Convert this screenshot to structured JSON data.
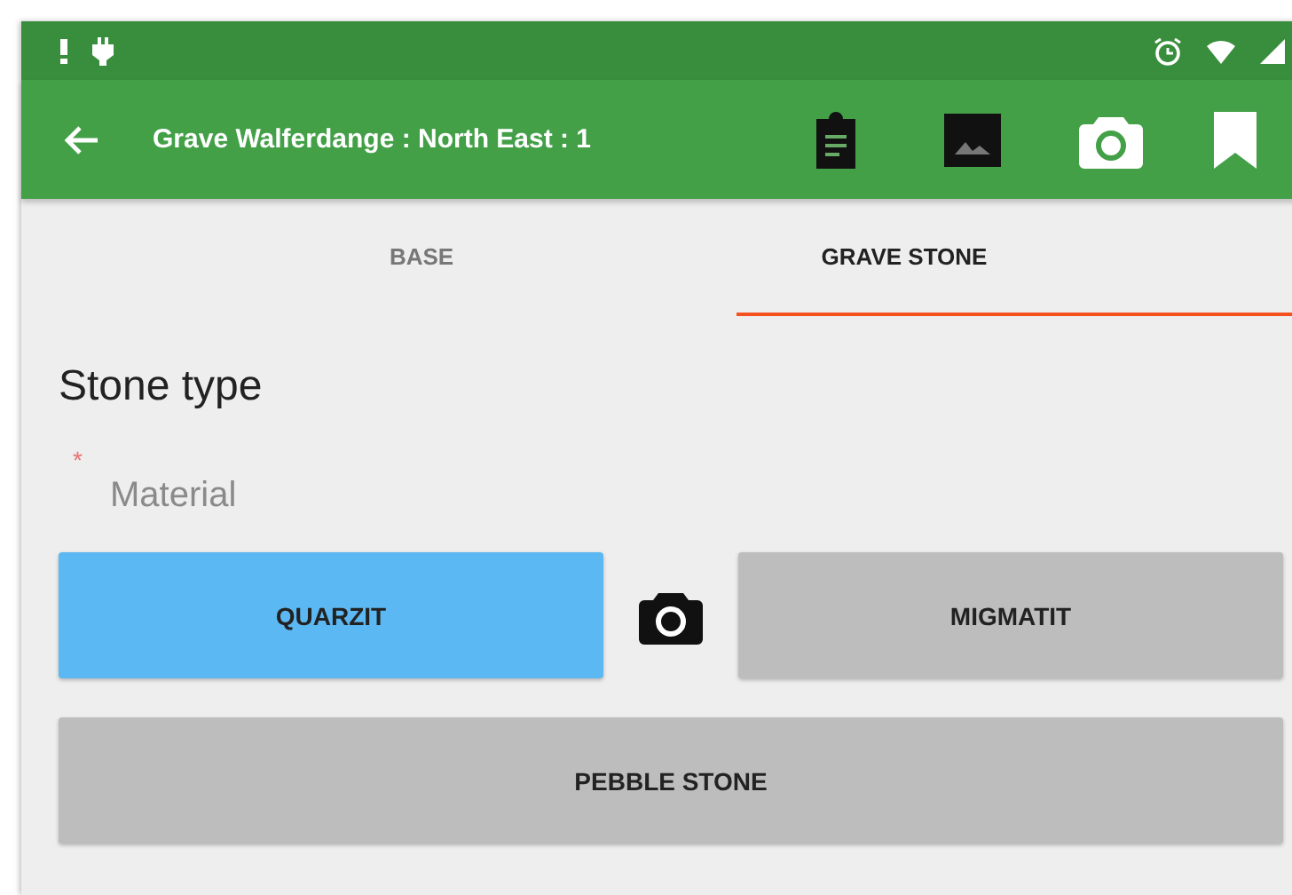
{
  "toolbar": {
    "title": "Grave Walferdange : North East : 1"
  },
  "tabs": [
    {
      "label": "BASE",
      "selected": false
    },
    {
      "label": "GRAVE STONE",
      "selected": true
    }
  ],
  "section": {
    "title": "Stone type"
  },
  "material": {
    "required_mark": "*",
    "label": "Material",
    "options": [
      {
        "label": "QUARZIT",
        "selected": true,
        "kind": "half"
      },
      {
        "kind": "camera"
      },
      {
        "label": "MIGMATIT",
        "selected": false,
        "kind": "half"
      },
      {
        "label": "PEBBLE STONE",
        "selected": false,
        "kind": "full"
      }
    ]
  }
}
